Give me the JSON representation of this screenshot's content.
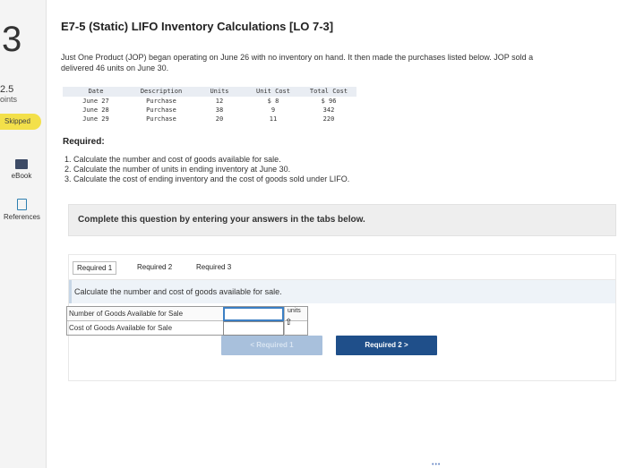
{
  "question": {
    "number": "3",
    "points_value": "2.5",
    "points_label": "oints",
    "status": "Skipped"
  },
  "rail": {
    "ebook": "eBook",
    "references": "References"
  },
  "header": {
    "title": "E7-5 (Static) LIFO Inventory Calculations [LO 7-3]",
    "intro_line1": "Just One Product (JOP) began operating on June 26 with no inventory on hand. It then made the purchases listed below. JOP sold a",
    "intro_line2": "delivered 46 units on June 30."
  },
  "inventory_table": {
    "headers": [
      "Date",
      "Description",
      "Units",
      "Unit Cost",
      "Total Cost"
    ],
    "rows": [
      [
        "June 27",
        "Purchase",
        "12",
        "$ 8",
        "$ 96"
      ],
      [
        "June 28",
        "Purchase",
        "38",
        "9",
        "342"
      ],
      [
        "June 29",
        "Purchase",
        "20",
        "11",
        "220"
      ]
    ]
  },
  "required": {
    "heading": "Required:",
    "items": [
      "1. Calculate the number and cost of goods available for sale.",
      "2. Calculate the number of units in ending inventory at June 30.",
      "3. Calculate the cost of ending inventory and the cost of goods sold under LIFO."
    ]
  },
  "banner": {
    "text": "Complete this question by entering your answers in the tabs below."
  },
  "tabs": [
    {
      "label": "Required 1",
      "active": true
    },
    {
      "label": "Required 2",
      "active": false
    },
    {
      "label": "Required 3",
      "active": false
    }
  ],
  "panel": {
    "instruction": "Calculate the number and cost of goods available for sale.",
    "rows": [
      {
        "label": "Number of Goods Available for Sale",
        "value": "",
        "unit": "units"
      },
      {
        "label": "Cost of Goods Available for Sale",
        "value": "",
        "unit": ""
      }
    ]
  },
  "nav": {
    "prev_label": "< Required 1",
    "next_label": "Required 2 >"
  },
  "footer": {
    "dots": "•••"
  }
}
